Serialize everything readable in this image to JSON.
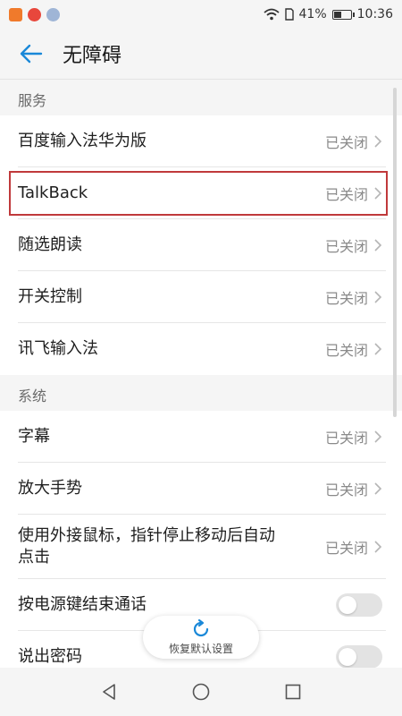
{
  "status_bar": {
    "battery": "41%",
    "time": "10:36",
    "battery_level": 0.41
  },
  "header": {
    "title": "无障碍"
  },
  "sections": [
    {
      "title": "服务",
      "items": [
        {
          "label": "百度输入法华为版",
          "value": "已关闭"
        },
        {
          "label": "TalkBack",
          "value": "已关闭",
          "highlighted": true
        },
        {
          "label": "随选朗读",
          "value": "已关闭"
        },
        {
          "label": "开关控制",
          "value": "已关闭"
        },
        {
          "label": "讯飞输入法",
          "value": "已关闭"
        }
      ]
    },
    {
      "title": "系统",
      "items": [
        {
          "label": "字幕",
          "value": "已关闭"
        },
        {
          "label": "放大手势",
          "value": "已关闭"
        },
        {
          "label": "使用外接鼠标，指针停止移动后自动点击",
          "value": "已关闭"
        },
        {
          "label": "按电源键结束通话",
          "toggle": false
        },
        {
          "label": "说出密码",
          "toggle": false
        }
      ]
    }
  ],
  "restore_button": {
    "label": "恢复默认设置"
  },
  "colors": {
    "accent": "#1a88d8",
    "highlight_border": "#c0393b"
  }
}
